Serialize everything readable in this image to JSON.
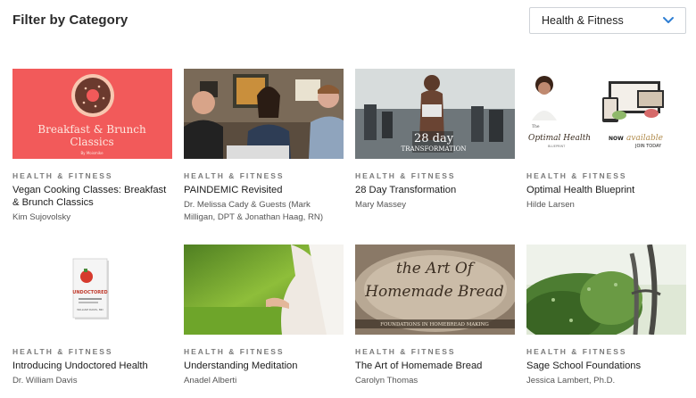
{
  "header": {
    "title": "Filter by Category",
    "select": {
      "value": "Health & Fitness",
      "icon": "chevron-down-icon",
      "accent": "#2f7fd3"
    }
  },
  "courses": [
    {
      "category": "HEALTH & FITNESS",
      "title": "Vegan Cooking Classes: Breakfast & Brunch Classics",
      "author": "Kim Sujovolsky",
      "thumb": {
        "text1": "Breakfast & Brunch",
        "text2": "Classics",
        "small": "By Moismike"
      }
    },
    {
      "category": "HEALTH & FITNESS",
      "title": "PAINDEMIC Revisited",
      "author": "Dr. Melissa Cady & Guests (Mark Milligan, DPT & Jonathan Haag, RN)"
    },
    {
      "category": "HEALTH & FITNESS",
      "title": "28 Day Transformation",
      "author": "Mary Massey",
      "thumb": {
        "text1": "28 day",
        "text2": "TRANSFORMATION"
      }
    },
    {
      "category": "HEALTH & FITNESS",
      "title": "Optimal Health Blueprint",
      "author": "Hilde Larsen",
      "thumb": {
        "text1": "The",
        "text2": "Optimal Health",
        "text3": "BLUEPRINT",
        "text4": "NOW",
        "text5": "available",
        "text6": "JOIN TODAY"
      }
    },
    {
      "category": "HEALTH & FITNESS",
      "title": "Introducing Undoctored Health",
      "author": "Dr. William Davis",
      "thumb": {
        "text1": "UNDOCTORED",
        "text2": "WILLIAM DAVIS, MD"
      }
    },
    {
      "category": "HEALTH & FITNESS",
      "title": "Understanding Meditation",
      "author": "Anadel Alberti"
    },
    {
      "category": "HEALTH & FITNESS",
      "title": "The Art of Homemade Bread",
      "author": "Carolyn Thomas",
      "thumb": {
        "text1": "the Art Of",
        "text2": "Homemade Bread",
        "text3": "FOUNDATIONS IN HOMEBREAD MAKING"
      }
    },
    {
      "category": "HEALTH & FITNESS",
      "title": "Sage School Foundations",
      "author": "Jessica Lambert, Ph.D."
    }
  ]
}
